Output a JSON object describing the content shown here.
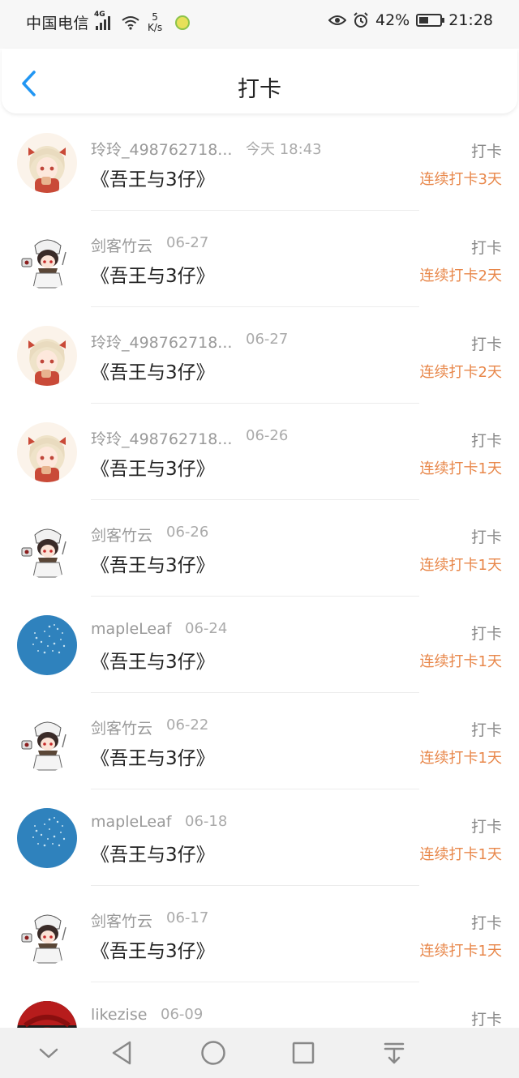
{
  "status_bar": {
    "carrier": "中国电信",
    "network": "4G",
    "speed_value": "5",
    "speed_unit": "K/s",
    "battery": "42%",
    "time": "21:28"
  },
  "header": {
    "title": "打卡"
  },
  "colors": {
    "accent_blue": "#2196f3",
    "streak_orange": "#e8874a"
  },
  "items": [
    {
      "name": "玲玲_498762718...",
      "date": "今天 18:43",
      "book": "《吾王与3仔》",
      "tag": "打卡",
      "streak": "连续打卡3天",
      "avatar": "girl-avatar"
    },
    {
      "name": "剑客竹云",
      "date": "06-27",
      "book": "《吾王与3仔》",
      "tag": "打卡",
      "streak": "连续打卡2天",
      "avatar": "boy-avatar"
    },
    {
      "name": "玲玲_498762718...",
      "date": "06-27",
      "book": "《吾王与3仔》",
      "tag": "打卡",
      "streak": "连续打卡2天",
      "avatar": "girl-avatar"
    },
    {
      "name": "玲玲_498762718...",
      "date": "06-26",
      "book": "《吾王与3仔》",
      "tag": "打卡",
      "streak": "连续打卡1天",
      "avatar": "girl-avatar"
    },
    {
      "name": "剑客竹云",
      "date": "06-26",
      "book": "《吾王与3仔》",
      "tag": "打卡",
      "streak": "连续打卡1天",
      "avatar": "boy-avatar"
    },
    {
      "name": "mapleLeaf",
      "date": "06-24",
      "book": "《吾王与3仔》",
      "tag": "打卡",
      "streak": "连续打卡1天",
      "avatar": "blue-avatar"
    },
    {
      "name": "剑客竹云",
      "date": "06-22",
      "book": "《吾王与3仔》",
      "tag": "打卡",
      "streak": "连续打卡1天",
      "avatar": "boy-avatar"
    },
    {
      "name": "mapleLeaf",
      "date": "06-18",
      "book": "《吾王与3仔》",
      "tag": "打卡",
      "streak": "连续打卡1天",
      "avatar": "blue-avatar"
    },
    {
      "name": "剑客竹云",
      "date": "06-17",
      "book": "《吾王与3仔》",
      "tag": "打卡",
      "streak": "连续打卡1天",
      "avatar": "boy-avatar"
    },
    {
      "name": "likezise",
      "date": "06-09",
      "book": "",
      "tag": "打卡",
      "streak": "",
      "avatar": "red-avatar"
    }
  ],
  "nav": [
    "chevron-down-icon",
    "back-triangle-icon",
    "home-circle-icon",
    "recents-square-icon",
    "notification-pull-icon"
  ]
}
